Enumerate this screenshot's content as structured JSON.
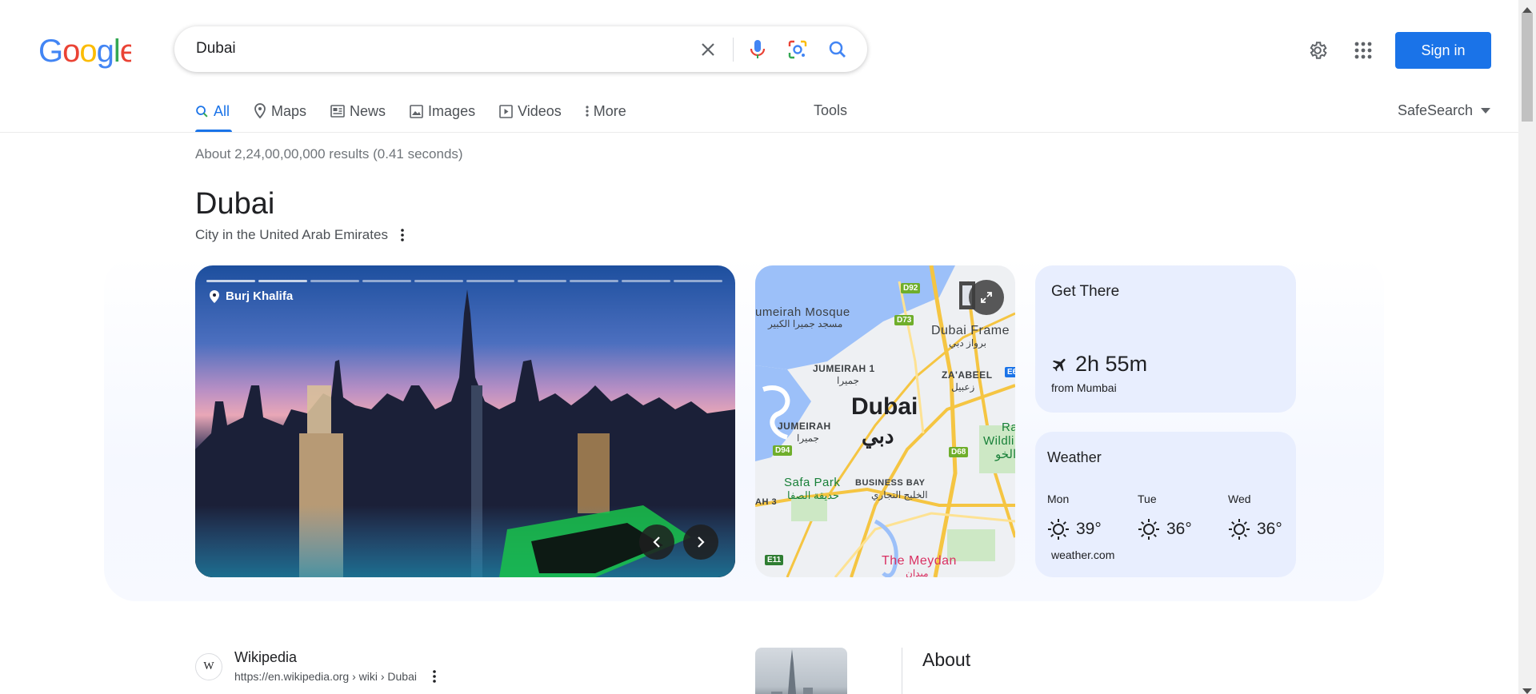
{
  "search": {
    "query": "Dubai"
  },
  "header": {
    "sign_in_label": "Sign in"
  },
  "tabs": [
    {
      "label": "All",
      "icon": "search-icon",
      "active": true
    },
    {
      "label": "Maps",
      "icon": "map-pin-icon"
    },
    {
      "label": "News",
      "icon": "news-icon"
    },
    {
      "label": "Images",
      "icon": "image-icon"
    },
    {
      "label": "Videos",
      "icon": "video-icon"
    },
    {
      "label": "More",
      "icon": "more-vert-icon"
    }
  ],
  "tools_label": "Tools",
  "safesearch_label": "SafeSearch",
  "results_count": "About 2,24,00,00,000 results (0.41 seconds)",
  "entity": {
    "title": "Dubai",
    "subtitle": "City in the United Arab Emirates"
  },
  "photo": {
    "place_label": "Burj Khalifa",
    "progress_total": 10,
    "progress_active": 2
  },
  "map": {
    "city": "Dubai",
    "city_ar": "دبي",
    "labels": {
      "mosque": "umeirah Mosque",
      "mosque_ar": "مسجد جميرا الكبير",
      "frame": "Dubai Frame",
      "frame_ar": "برواز دبي",
      "jumeirah1": "JUMEIRAH 1",
      "jumeirah1_ar": "جميرا",
      "zaabeel": "ZA'ABEEL",
      "zaabeel_ar": "زعبيل",
      "jumeirah": "JUMEIRAH",
      "jumeirah_ar": "جميرا",
      "ras": "Ra",
      "wildli": "Wildli",
      "wildli_ar": "الخو",
      "safa": "Safa Park",
      "safa_ar": "حديقة الصفا",
      "business_bay": "BUSINESS BAY",
      "business_bay_ar": "الخليج التجاري",
      "ah3": "AH 3",
      "meydan": "The Meydan",
      "meydan_ar": "ميدان"
    },
    "shields": {
      "d92": "D92",
      "d73": "D73",
      "d94": "D94",
      "d68": "D68",
      "e11": "E11",
      "e6": "E6"
    }
  },
  "get_there": {
    "title": "Get There",
    "duration": "2h 55m",
    "from": "from Mumbai"
  },
  "weather": {
    "title": "Weather",
    "days": [
      {
        "day": "Mon",
        "temp": "39°",
        "icon": "sun-icon"
      },
      {
        "day": "Tue",
        "temp": "36°",
        "icon": "sun-icon"
      },
      {
        "day": "Wed",
        "temp": "36°",
        "icon": "sun-icon"
      }
    ],
    "source": "weather.com"
  },
  "wiki_result": {
    "favicon": "W",
    "site": "Wikipedia",
    "url": "https://en.wikipedia.org › wiki › Dubai"
  },
  "about_heading": "About",
  "colors": {
    "accent": "#1a73e8",
    "card_bg": "#e8eefe"
  }
}
